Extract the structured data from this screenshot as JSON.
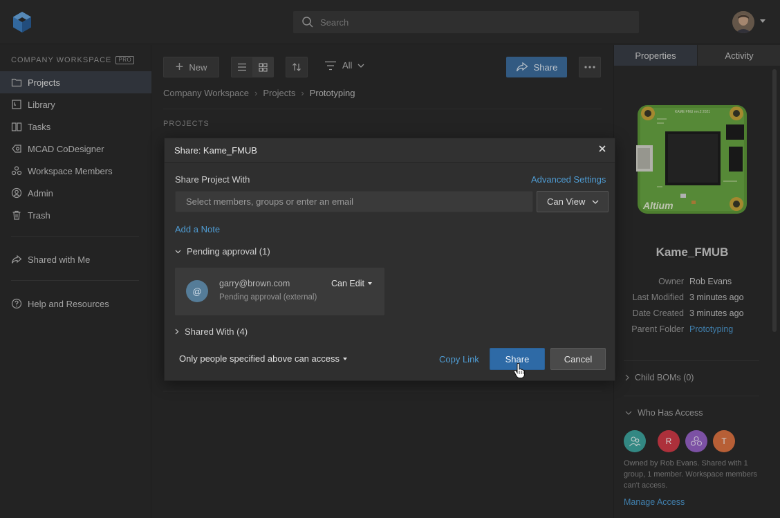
{
  "search": {
    "placeholder": "Search"
  },
  "sidebar": {
    "workspace_title": "COMPANY WORKSPACE",
    "workspace_badge": "PRO",
    "items": [
      {
        "label": "Projects",
        "icon": "folder-icon"
      },
      {
        "label": "Library",
        "icon": "library-icon"
      },
      {
        "label": "Tasks",
        "icon": "tasks-icon"
      },
      {
        "label": "MCAD CoDesigner",
        "icon": "mcad-icon"
      },
      {
        "label": "Workspace Members",
        "icon": "members-icon"
      },
      {
        "label": "Admin",
        "icon": "admin-icon"
      },
      {
        "label": "Trash",
        "icon": "trash-icon"
      }
    ],
    "shared_with_me": "Shared with Me",
    "help": "Help and Resources"
  },
  "toolbar": {
    "new_label": "New",
    "filter_label": "All",
    "share_label": "Share"
  },
  "breadcrumb": [
    "Company Workspace",
    "Projects",
    "Prototyping"
  ],
  "main": {
    "section_label": "PROJECTS"
  },
  "right_panel": {
    "tabs": [
      "Properties",
      "Activity"
    ],
    "project_name": "Kame_FMUB",
    "pcb_text": "KAME FMU rev.2 2021",
    "pcb_logo": "Altium",
    "meta": [
      {
        "key": "Owner",
        "value": "Rob Evans"
      },
      {
        "key": "Last Modified",
        "value": "3 minutes ago"
      },
      {
        "key": "Date Created",
        "value": "3 minutes ago"
      },
      {
        "key": "Parent Folder",
        "value": "Prototyping"
      }
    ],
    "child_boms": "Child BOMs (0)",
    "who_has_access": "Who Has Access",
    "avatars": [
      "R",
      "T"
    ],
    "access_note": "Owned by Rob Evans. Shared with 1 group, 1 member. Workspace members can't access.",
    "manage_access": "Manage Access"
  },
  "modal": {
    "title": "Share: Kame_FMUB",
    "share_with_label": "Share Project With",
    "advanced_settings": "Advanced Settings",
    "input_placeholder": "Select members, groups or enter an email",
    "permission": "Can View",
    "add_note": "Add a Note",
    "pending_header": "Pending approval (1)",
    "pending": {
      "avatar_char": "@",
      "email": "garry@brown.com",
      "status": "Pending approval (external)",
      "permission": "Can Edit"
    },
    "shared_header": "Shared With (4)",
    "access_scope": "Only people specified above can access",
    "copy_link": "Copy Link",
    "share_button": "Share",
    "cancel_button": "Cancel"
  },
  "colors": {
    "accent": "#4f9cd3",
    "primary_button": "#2e6aa6",
    "background": "#2b2b2b"
  }
}
